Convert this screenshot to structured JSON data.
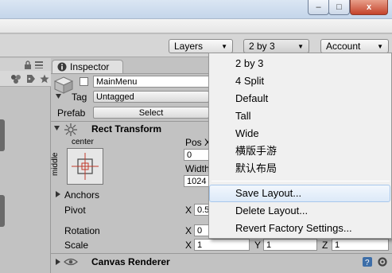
{
  "window": {
    "minimize_glyph": "–",
    "maximize_glyph": "□",
    "close_glyph": "x"
  },
  "toolbar": {
    "layers_label": "Layers",
    "layout_label": "2 by 3",
    "account_label": "Account",
    "arrow": "▼"
  },
  "inspector": {
    "tab_label": "Inspector",
    "name_value": "MainMenu",
    "tag_label": "Tag",
    "tag_value": "Untagged",
    "prefab_label": "Prefab",
    "select_label": "Select",
    "rect_transform_title": "Rect Transform",
    "anchor_preset_top": "center",
    "anchor_preset_side": "middle",
    "pos_label": "Pos X",
    "pos_value": "0",
    "width_label": "Width",
    "width_value": "1024",
    "anchors_label": "Anchors",
    "pivot_label": "Pivot",
    "pivot_x_label": "X",
    "pivot_x_value": "0.5",
    "rotation_label": "Rotation",
    "rotation_x_label": "X",
    "rotation_x_value": "0",
    "scale_label": "Scale",
    "scale_x_label": "X",
    "scale_x_value": "1",
    "scale_y_label": "Y",
    "scale_y_value": "1",
    "scale_z_label": "Z",
    "scale_z_value": "1",
    "canvas_renderer_title": "Canvas Renderer"
  },
  "layout_menu": {
    "items": [
      "2 by 3",
      "4 Split",
      "Default",
      "Tall",
      "Wide",
      "横版手游",
      "默认布局"
    ],
    "actions": [
      "Save Layout...",
      "Delete Layout...",
      "Revert Factory Settings..."
    ],
    "hovered": "Save Layout..."
  },
  "colors": {
    "hover_border": "#a8c8ec",
    "rect_icon_red": "#c0392b"
  }
}
